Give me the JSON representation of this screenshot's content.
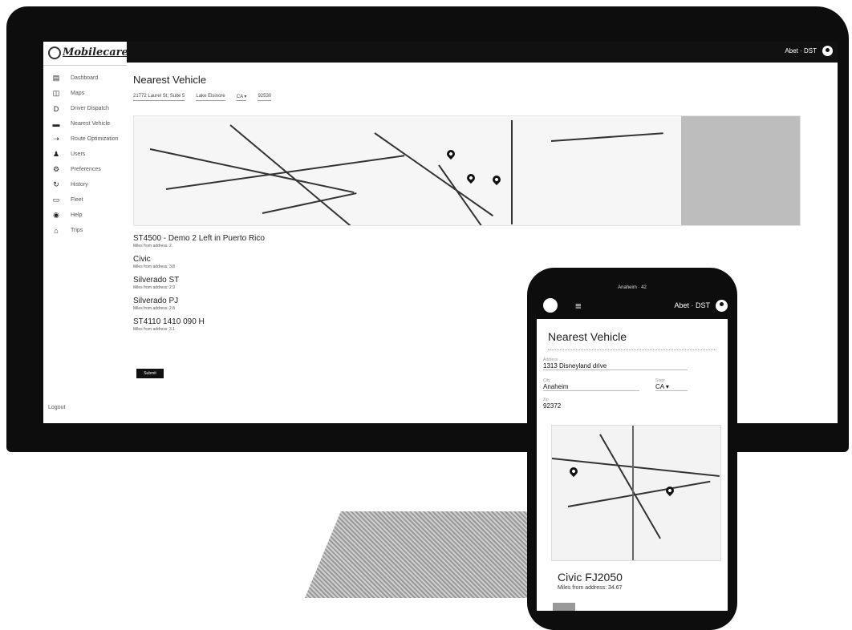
{
  "desktop": {
    "logo": "Mobilecare",
    "user": "Abet · DST",
    "sidebar": [
      {
        "icon": "dashboard-icon",
        "glyph": "▤",
        "label": "Dashboard"
      },
      {
        "icon": "maps-icon",
        "glyph": "◫",
        "label": "Maps"
      },
      {
        "icon": "dispatch-icon",
        "glyph": "D",
        "label": "Driver Dispatch"
      },
      {
        "icon": "vehicle-icon",
        "glyph": "▬",
        "label": "Nearest Vehicle"
      },
      {
        "icon": "routes-icon",
        "glyph": "⇢",
        "label": "Route Optimization"
      },
      {
        "icon": "users-icon",
        "glyph": "♟",
        "label": "Users"
      },
      {
        "icon": "settings-icon",
        "glyph": "⚙",
        "label": "Preferences"
      },
      {
        "icon": "history-icon",
        "glyph": "↻",
        "label": "History"
      },
      {
        "icon": "fleet-icon",
        "glyph": "▭",
        "label": "Fleet"
      },
      {
        "icon": "help-icon",
        "glyph": "◉",
        "label": "Help"
      },
      {
        "icon": "trips-icon",
        "glyph": "⌂",
        "label": "Trips"
      }
    ],
    "logout": "Logout",
    "title": "Nearest Vehicle",
    "form": {
      "address": "21772 Laurel St, Suite 5",
      "city": "Lake Elsinore",
      "state": "CA",
      "zip": "92530"
    },
    "vehicles": [
      {
        "name": "ST4500 - Demo 2 Left in Puerto Rico",
        "meta": "Miles from address: 2"
      },
      {
        "name": "Civic",
        "meta": "Miles from address: 3.8"
      },
      {
        "name": "Silverado ST",
        "meta": "Miles from address: 2.9"
      },
      {
        "name": "Silverado PJ",
        "meta": "Miles from address: 2.8"
      },
      {
        "name": "ST4110 1410 090 H",
        "meta": "Miles from address: 3.1"
      }
    ],
    "submit": "Submit"
  },
  "phone": {
    "status": "Anaheim · 42",
    "menu_glyph": "≡",
    "user": "Abet · DST",
    "title": "Nearest Vehicle",
    "address_label": "Address",
    "address": "1313 Disneyland drive",
    "city_label": "City",
    "city": "Anaheim",
    "state_label": "State",
    "state": "CA",
    "zip_label": "Zip",
    "zip": "92372",
    "vehicle_name": "Civic FJ2050",
    "vehicle_meta": "Miles from address: 34.67"
  }
}
